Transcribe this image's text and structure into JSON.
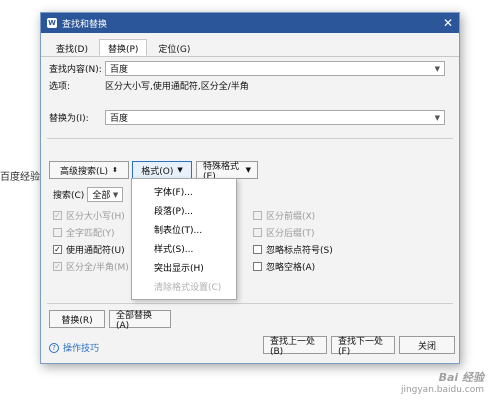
{
  "background": {
    "side_text": "百度经验"
  },
  "dialog": {
    "title": "查找和替换",
    "tabs": [
      {
        "label": "查找(D)",
        "active": false
      },
      {
        "label": "替换(P)",
        "active": true
      },
      {
        "label": "定位(G)",
        "active": false
      }
    ],
    "find_label": "查找内容(N):",
    "find_value": "百度",
    "options_label": "选项:",
    "options_value": "区分大小写,使用通配符,区分全/半角",
    "replace_label": "替换为(I):",
    "replace_value": "百度",
    "advanced_button": "高级搜索(L)",
    "format_button": "格式(O)",
    "special_button": "特殊格式(E)",
    "search_label": "搜索(C)",
    "search_scope": "全部",
    "left_checks": [
      {
        "label": "区分大小写(H)",
        "checked": true,
        "disabled": true
      },
      {
        "label": "全字匹配(Y)",
        "checked": false,
        "disabled": true
      },
      {
        "label": "使用通配符(U)",
        "checked": true,
        "disabled": false
      },
      {
        "label": "区分全/半角(M)",
        "checked": true,
        "disabled": true
      }
    ],
    "right_checks": [
      {
        "label": "区分前缀(X)",
        "checked": false,
        "disabled": true
      },
      {
        "label": "区分后缀(T)",
        "checked": false,
        "disabled": true
      },
      {
        "label": "忽略标点符号(S)",
        "checked": false,
        "disabled": false
      },
      {
        "label": "忽略空格(A)",
        "checked": false,
        "disabled": false
      }
    ],
    "format_menu": [
      {
        "label": "字体(F)...",
        "disabled": false
      },
      {
        "label": "段落(P)...",
        "disabled": false
      },
      {
        "label": "制表位(T)...",
        "disabled": false
      },
      {
        "label": "样式(S)...",
        "disabled": false
      },
      {
        "label": "突出显示(H)",
        "disabled": false
      },
      {
        "label": "清除格式设置(C)",
        "disabled": true
      }
    ],
    "replace_button": "替换(R)",
    "replace_all_button": "全部替换(A)",
    "tips_link": "操作技巧",
    "find_prev_button": "查找上一处(B)",
    "find_next_button": "查找下一处(F)",
    "close_button": "关闭"
  },
  "watermark": {
    "title": "Bai 经验",
    "url": "jingyan.baidu.com"
  }
}
